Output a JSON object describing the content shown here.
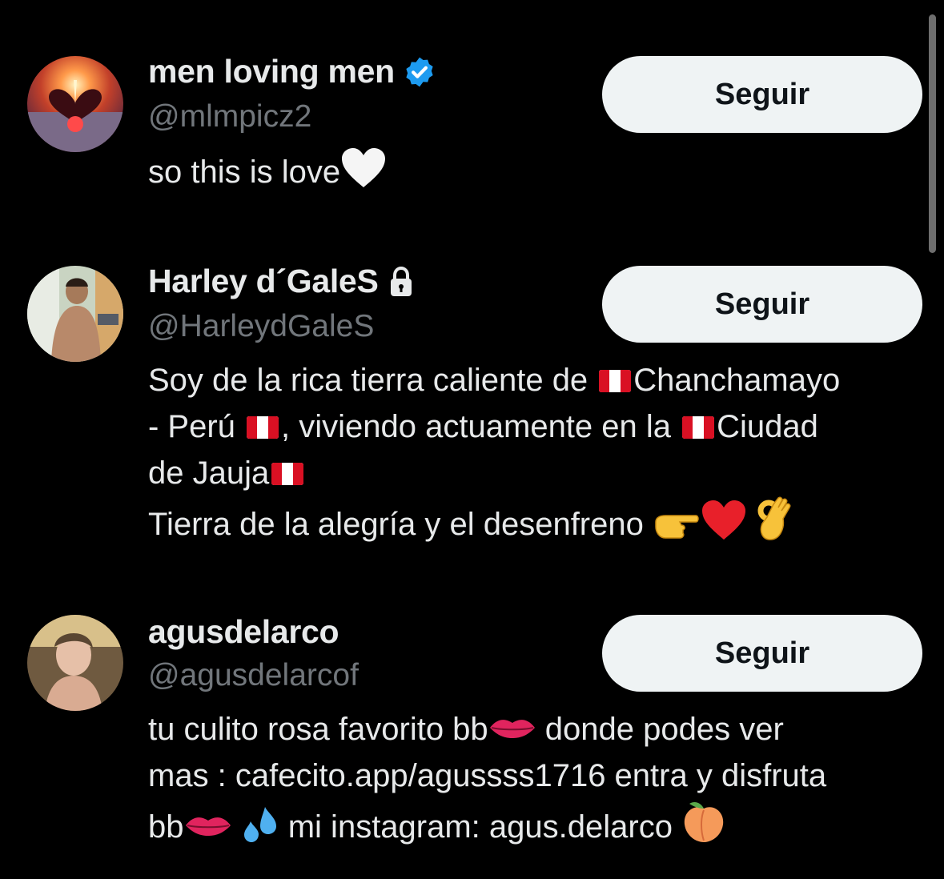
{
  "users": [
    {
      "name": "men loving men",
      "handle": "@mlmpicz2",
      "verified": true,
      "bio": "so this is love",
      "follow_label": "Seguir"
    },
    {
      "name": "Harley d´GaleS",
      "handle": "@HarleydGaleS",
      "protected": true,
      "bio_parts": {
        "p1": "Soy de la rica tierra caliente de ",
        "p2": "Chanchamayo",
        "p3": "- Perú ",
        "p4": ", viviendo actuamente en la ",
        "p5": "Ciudad",
        "p6": "de Jauja",
        "p7": "Tierra de la alegría y el desenfreno "
      },
      "follow_label": "Seguir"
    },
    {
      "name": "agusdelarco",
      "handle": "@agusdelarcof",
      "bio_parts": {
        "p1": "tu culito rosa favorito bb",
        "p2": " donde podes ver",
        "p3": "mas : cafecito.app/agussss1716 entra y disfruta",
        "p4": "bb",
        "p5": " mi instagram: agus.delarco "
      },
      "follow_label": "Seguir"
    }
  ],
  "icons": {
    "verified": "verified-badge-icon",
    "protected": "lock-icon",
    "heart_white": "white-heart-icon",
    "flag_peru": "peru-flag-icon",
    "pointing_hand": "backhand-index-pointing-right-icon",
    "heart_red": "red-heart-icon",
    "ok_hand": "ok-hand-icon",
    "lips": "lips-icon",
    "droplets": "sweat-droplets-icon",
    "peach": "peach-icon"
  },
  "colors": {
    "background": "#000000",
    "text": "#e7e9ea",
    "secondary_text": "#71767b",
    "button_bg": "#eff3f4",
    "button_text": "#0f1419",
    "verified_blue": "#1d9bf0"
  }
}
